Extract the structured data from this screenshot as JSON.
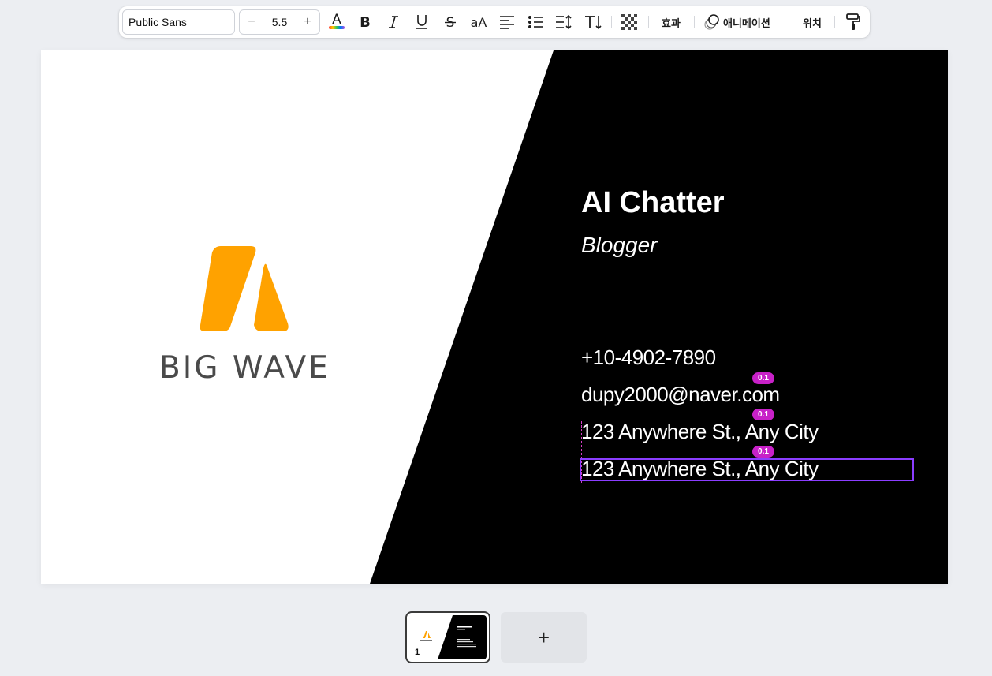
{
  "toolbar": {
    "font_name": "Public Sans",
    "font_size": "5.5",
    "decrease_label": "−",
    "increase_label": "+",
    "case_label": "aA",
    "effects_label": "효과",
    "animate_label": "애니메이션",
    "position_label": "위치",
    "icons": [
      "text-color-icon",
      "bold-icon",
      "italic-icon",
      "underline-icon",
      "strikethrough-icon",
      "letter-case-icon",
      "align-left-icon",
      "list-icon",
      "spacing-icon",
      "vertical-text-icon",
      "transparency-icon",
      "animate-icon",
      "paint-roller-icon"
    ]
  },
  "card": {
    "brand": "BIG WAVE",
    "name": "AI Chatter",
    "role": "Blogger",
    "phone": "+10-4902-7890",
    "email": "dupy2000@naver.com",
    "address1": "123 Anywhere St., Any City",
    "address2": "123 Anywhere St., Any City",
    "logo_color": "#FFA200",
    "spacing_badges": [
      "0.1",
      "0.1",
      "0.1"
    ]
  },
  "pages": {
    "current_number": "1",
    "add_label": "+"
  }
}
